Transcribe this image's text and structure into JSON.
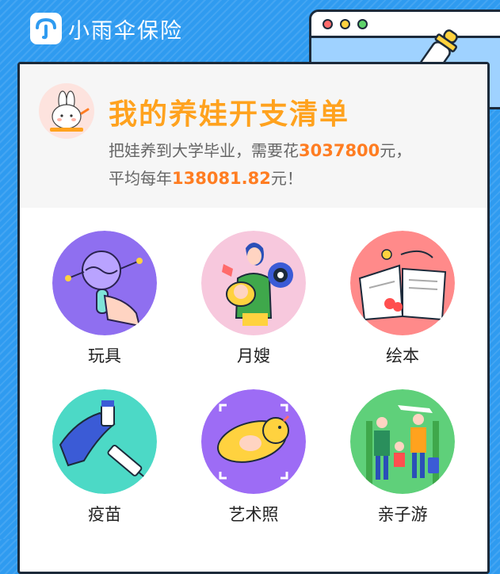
{
  "brand": {
    "name": "小雨伞保险"
  },
  "header": {
    "title": "我的养娃开支清单",
    "line1_prefix": "把娃养到大学毕业，需要花",
    "total_cost": "3037800",
    "line1_suffix": "元，",
    "line2_prefix": "平均每年",
    "yearly_cost": "138081.82",
    "line2_suffix": "元！"
  },
  "categories": [
    {
      "label": "玩具",
      "icon": "rattle-toy-icon"
    },
    {
      "label": "月嫂",
      "icon": "nanny-icon"
    },
    {
      "label": "绘本",
      "icon": "picture-book-icon"
    },
    {
      "label": "疫苗",
      "icon": "vaccine-icon"
    },
    {
      "label": "艺术照",
      "icon": "baby-photo-icon"
    },
    {
      "label": "亲子游",
      "icon": "family-trip-icon"
    }
  ],
  "colors": {
    "background": "#2f9bf0",
    "accent": "#ffa21e",
    "highlight": "#ff7d22"
  }
}
